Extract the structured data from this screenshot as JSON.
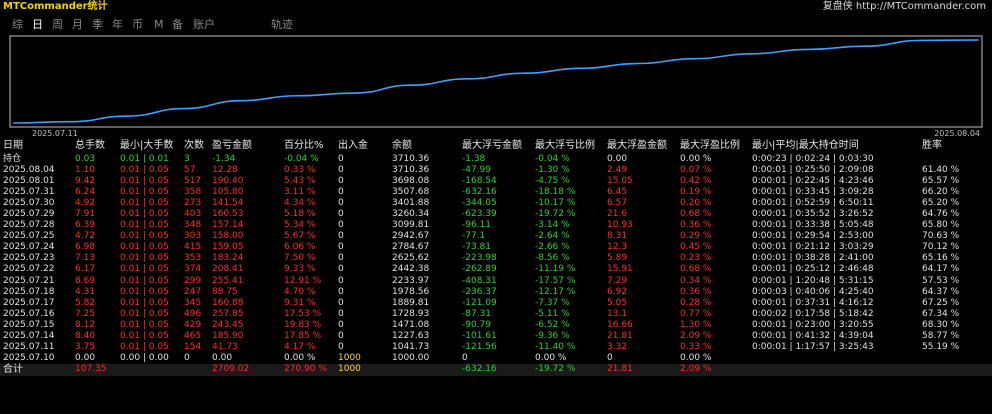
{
  "app": {
    "title": "MTCommander统计",
    "brand": "复盘侠 http://MTCommander.com"
  },
  "tabs": [
    {
      "label": "综",
      "active": false
    },
    {
      "label": "日",
      "active": true
    },
    {
      "label": "周",
      "active": false
    },
    {
      "label": "月",
      "active": false
    },
    {
      "label": "季",
      "active": false
    },
    {
      "label": "年",
      "active": false
    },
    {
      "label": "币",
      "active": false
    },
    {
      "label": "M",
      "active": false
    },
    {
      "label": "备",
      "active": false
    },
    {
      "label": "账户",
      "active": false
    },
    {
      "label": "轨迹",
      "active": false
    }
  ],
  "chart_data": {
    "type": "line",
    "x_start_label": "2025.07.11",
    "x_end_label": "2025.08.04",
    "x": [
      "2025.07.10",
      "2025.07.11",
      "2025.07.14",
      "2025.07.15",
      "2025.07.16",
      "2025.07.17",
      "2025.07.18",
      "2025.07.21",
      "2025.07.22",
      "2025.07.23",
      "2025.07.24",
      "2025.07.25",
      "2025.07.28",
      "2025.07.29",
      "2025.07.30",
      "2025.07.31",
      "2025.08.01",
      "2025.08.04"
    ],
    "values": [
      1000.0,
      1041.73,
      1227.63,
      1471.08,
      1728.93,
      1889.81,
      1978.56,
      2233.97,
      2442.38,
      2625.62,
      2784.67,
      2942.67,
      3099.81,
      3260.34,
      3401.88,
      3507.68,
      3698.08,
      3710.36
    ],
    "series_color": "#3aa0ff"
  },
  "table": {
    "headers": [
      "日期",
      "总手数",
      "最小|大手数",
      "次数",
      "盈亏金额",
      "百分比%",
      "出入金",
      "余额",
      "最大浮亏金额",
      "最大浮亏比例",
      "最大浮盈金额",
      "最大浮盈比例",
      "最小|平均|最大持仓时间",
      "胜率"
    ],
    "holding": {
      "label": "持仓",
      "lots": "0.03",
      "minmax": "0.01 | 0.01",
      "count": "3",
      "pnl": "-1.34",
      "pct": "-0.04 %",
      "deposit": "0",
      "balance": "3710.36",
      "max_dd": "-1.38",
      "max_dd_pct": "-0.04 %",
      "max_fp": "0.00",
      "max_fp_pct": "0.00 %",
      "hold_time": "0:00:23 | 0:02:24 | 0:03:30",
      "win": ""
    },
    "rows": [
      {
        "date": "2025.08.04",
        "lots": "1.10",
        "minmax": "0.01 | 0.05",
        "count": "57",
        "pnl": "12.28",
        "pct": "0.33 %",
        "deposit": "0",
        "balance": "3710.36",
        "max_dd": "-47.99",
        "max_dd_pct": "-1.30 %",
        "max_fp": "2.49",
        "max_fp_pct": "0.07 %",
        "hold_time": "0:00:01 | 0:25:50 | 2:09:08",
        "win": "61.40 %"
      },
      {
        "date": "2025.08.01",
        "lots": "9.42",
        "minmax": "0.01 | 0.05",
        "count": "517",
        "pnl": "190.40",
        "pct": "5.43 %",
        "deposit": "0",
        "balance": "3698.08",
        "max_dd": "-168.54",
        "max_dd_pct": "-4.75 %",
        "max_fp": "15.05",
        "max_fp_pct": "0.42 %",
        "hold_time": "0:00:01 | 0:22:45 | 4:23:46",
        "win": "65.57 %"
      },
      {
        "date": "2025.07.31",
        "lots": "6.24",
        "minmax": "0.01 | 0.05",
        "count": "358",
        "pnl": "105.80",
        "pct": "3.11 %",
        "deposit": "0",
        "balance": "3507.68",
        "max_dd": "-632.16",
        "max_dd_pct": "-18.18 %",
        "max_fp": "6.45",
        "max_fp_pct": "0.19 %",
        "hold_time": "0:00:01 | 0:33:45 | 3:09:28",
        "win": "66.20 %"
      },
      {
        "date": "2025.07.30",
        "lots": "4.92",
        "minmax": "0.01 | 0.05",
        "count": "273",
        "pnl": "141.54",
        "pct": "4.34 %",
        "deposit": "0",
        "balance": "3401.88",
        "max_dd": "-344.05",
        "max_dd_pct": "-10.17 %",
        "max_fp": "6.57",
        "max_fp_pct": "0.20 %",
        "hold_time": "0:00:01 | 0:52:59 | 6:50:11",
        "win": "65.20 %"
      },
      {
        "date": "2025.07.29",
        "lots": "7.91",
        "minmax": "0.01 | 0.05",
        "count": "403",
        "pnl": "160.53",
        "pct": "5.18 %",
        "deposit": "0",
        "balance": "3260.34",
        "max_dd": "-623.39",
        "max_dd_pct": "-19.72 %",
        "max_fp": "21.6",
        "max_fp_pct": "0.68 %",
        "hold_time": "0:00:01 | 0:35:52 | 3:26:52",
        "win": "64.76 %"
      },
      {
        "date": "2025.07.28",
        "lots": "6.39",
        "minmax": "0.01 | 0.05",
        "count": "348",
        "pnl": "157.14",
        "pct": "5.34 %",
        "deposit": "0",
        "balance": "3099.81",
        "max_dd": "-96.11",
        "max_dd_pct": "-3.14 %",
        "max_fp": "10.93",
        "max_fp_pct": "0.36 %",
        "hold_time": "0:00:01 | 0:33:38 | 5:05:48",
        "win": "65.80 %"
      },
      {
        "date": "2025.07.25",
        "lots": "4.72",
        "minmax": "0.01 | 0.05",
        "count": "303",
        "pnl": "158.00",
        "pct": "5.67 %",
        "deposit": "0",
        "balance": "2942.67",
        "max_dd": "-77.1",
        "max_dd_pct": "-2.64 %",
        "max_fp": "8.31",
        "max_fp_pct": "0.29 %",
        "hold_time": "0:00:01 | 0:29:54 | 2:53:00",
        "win": "70.63 %"
      },
      {
        "date": "2025.07.24",
        "lots": "6.98",
        "minmax": "0.01 | 0.05",
        "count": "415",
        "pnl": "159.05",
        "pct": "6.06 %",
        "deposit": "0",
        "balance": "2784.67",
        "max_dd": "-73.81",
        "max_dd_pct": "-2.66 %",
        "max_fp": "12.3",
        "max_fp_pct": "0.45 %",
        "hold_time": "0:00:01 | 0:21:12 | 3:03:29",
        "win": "70.12 %"
      },
      {
        "date": "2025.07.23",
        "lots": "7.13",
        "minmax": "0.01 | 0.05",
        "count": "353",
        "pnl": "183.24",
        "pct": "7.50 %",
        "deposit": "0",
        "balance": "2625.62",
        "max_dd": "-223.98",
        "max_dd_pct": "-8.56 %",
        "max_fp": "5.89",
        "max_fp_pct": "0.23 %",
        "hold_time": "0:00:01 | 0:38:28 | 2:41:00",
        "win": "65.16 %"
      },
      {
        "date": "2025.07.22",
        "lots": "6.17",
        "minmax": "0.01 | 0.05",
        "count": "374",
        "pnl": "208.41",
        "pct": "9.33 %",
        "deposit": "0",
        "balance": "2442.38",
        "max_dd": "-262.89",
        "max_dd_pct": "-11.19 %",
        "max_fp": "15.91",
        "max_fp_pct": "0.68 %",
        "hold_time": "0:00:01 | 0:25:12 | 2:46:48",
        "win": "64.17 %"
      },
      {
        "date": "2025.07.21",
        "lots": "8.69",
        "minmax": "0.01 | 0.05",
        "count": "299",
        "pnl": "255.41",
        "pct": "12.91 %",
        "deposit": "0",
        "balance": "2233.97",
        "max_dd": "-408.31",
        "max_dd_pct": "-17.57 %",
        "max_fp": "7.29",
        "max_fp_pct": "0.34 %",
        "hold_time": "0:00:01 | 1:20:48 | 5:31:15",
        "win": "57.53 %"
      },
      {
        "date": "2025.07.18",
        "lots": "4.31",
        "minmax": "0.01 | 0.05",
        "count": "247",
        "pnl": "88.75",
        "pct": "4.70 %",
        "deposit": "0",
        "balance": "1978.56",
        "max_dd": "-236.37",
        "max_dd_pct": "-12.17 %",
        "max_fp": "6.92",
        "max_fp_pct": "0.36 %",
        "hold_time": "0:00:03 | 0:40:06 | 4:25:40",
        "win": "64.37 %"
      },
      {
        "date": "2025.07.17",
        "lots": "5.82",
        "minmax": "0.01 | 0.05",
        "count": "345",
        "pnl": "160.88",
        "pct": "9.31 %",
        "deposit": "0",
        "balance": "1889.81",
        "max_dd": "-121.09",
        "max_dd_pct": "-7.37 %",
        "max_fp": "5.05",
        "max_fp_pct": "0.28 %",
        "hold_time": "0:00:01 | 0:37:31 | 4:16:12",
        "win": "67.25 %"
      },
      {
        "date": "2025.07.16",
        "lots": "7.25",
        "minmax": "0.01 | 0.05",
        "count": "496",
        "pnl": "257.85",
        "pct": "17.53 %",
        "deposit": "0",
        "balance": "1728.93",
        "max_dd": "-87.31",
        "max_dd_pct": "-5.11 %",
        "max_fp": "13.1",
        "max_fp_pct": "0.77 %",
        "hold_time": "0:00:02 | 0:17:58 | 5:18:42",
        "win": "67.34 %"
      },
      {
        "date": "2025.07.15",
        "lots": "8.12",
        "minmax": "0.01 | 0.05",
        "count": "429",
        "pnl": "243.45",
        "pct": "19.83 %",
        "deposit": "0",
        "balance": "1471.08",
        "max_dd": "-90.79",
        "max_dd_pct": "-6.52 %",
        "max_fp": "16.66",
        "max_fp_pct": "1.30 %",
        "hold_time": "0:00:01 | 0:23:00 | 3:20:55",
        "win": "68.30 %"
      },
      {
        "date": "2025.07.14",
        "lots": "8.40",
        "minmax": "0.01 | 0.05",
        "count": "465",
        "pnl": "185.90",
        "pct": "17.85 %",
        "deposit": "0",
        "balance": "1227.63",
        "max_dd": "-101.61",
        "max_dd_pct": "-9.36 %",
        "max_fp": "21.81",
        "max_fp_pct": "2.09 %",
        "hold_time": "0:00:01 | 0:41:32 | 4:39:04",
        "win": "58.77 %"
      },
      {
        "date": "2025.07.11",
        "lots": "3.75",
        "minmax": "0.01 | 0.05",
        "count": "154",
        "pnl": "41.73",
        "pct": "4.17 %",
        "deposit": "0",
        "balance": "1041.73",
        "max_dd": "-121.56",
        "max_dd_pct": "-11.40 %",
        "max_fp": "3.32",
        "max_fp_pct": "0.33 %",
        "hold_time": "0:00:01 | 1:17:57 | 3:25:43",
        "win": "55.19 %"
      },
      {
        "date": "2025.07.10",
        "lots": "0.00",
        "minmax": "0.00 | 0.00",
        "count": "0",
        "pnl": "0.00",
        "pct": "0.00 %",
        "deposit": "1000",
        "balance": "1000.00",
        "max_dd": "0",
        "max_dd_pct": "0.00 %",
        "max_fp": "0",
        "max_fp_pct": "0.00 %",
        "hold_time": "",
        "win": ""
      }
    ],
    "total": {
      "label": "合计",
      "lots": "107.35",
      "pnl": "2709.02",
      "pct": "270.90 %",
      "deposit": "1000",
      "max_dd": "-632.16",
      "max_dd_pct": "-19.72 %",
      "max_fp": "21.81",
      "max_fp_pct": "2.09 %"
    }
  }
}
